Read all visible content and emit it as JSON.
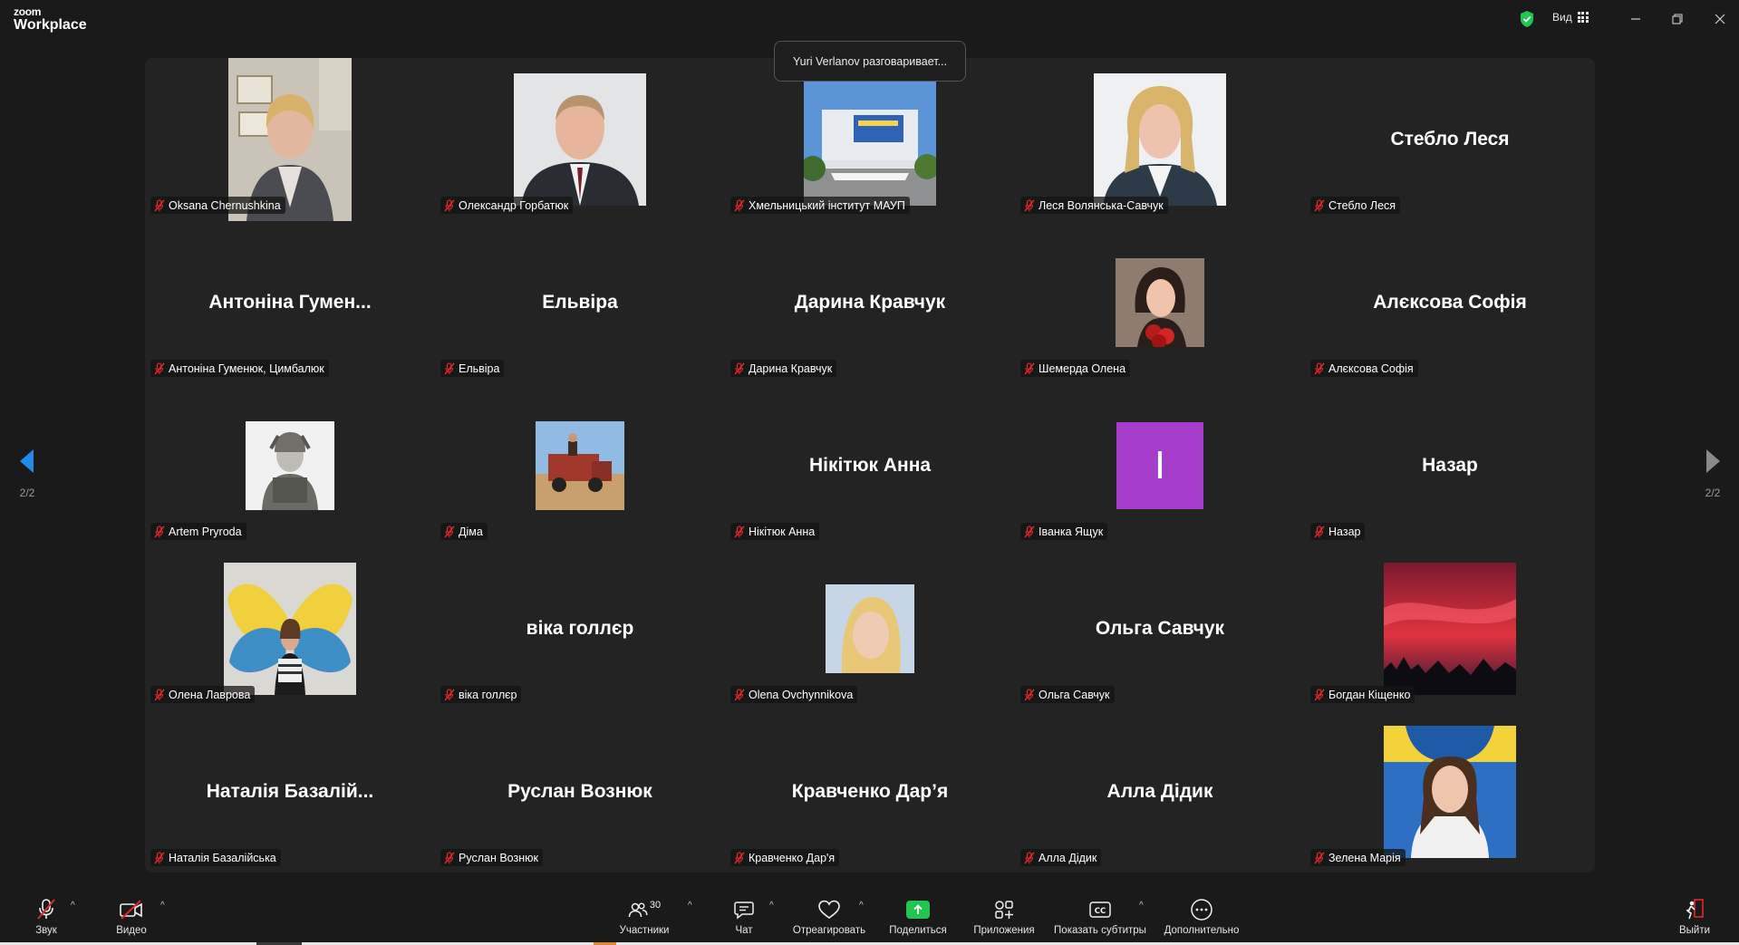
{
  "app": {
    "logo_line1": "zoom",
    "logo_line2": "Workplace",
    "view_label": "Вид"
  },
  "speaking_notice": "Yuri Verlanov разговаривает...",
  "pager": {
    "left": "2/2",
    "right": "2/2"
  },
  "participants": [
    {
      "label": "Oksana Chernushkina",
      "display": "photo",
      "photo_theme": "office-woman"
    },
    {
      "label": "Олександр Горбатюк",
      "display": "photo",
      "photo_theme": "suit-man"
    },
    {
      "label": "Хмельницький інститут МАУП",
      "display": "photo",
      "photo_theme": "building"
    },
    {
      "label": "Леся Волянська-Савчук",
      "display": "photo",
      "photo_theme": "blonde-woman"
    },
    {
      "label": "Стебло Леся",
      "display": "name",
      "name": "Стебло Леся"
    },
    {
      "label": "Антоніна Гуменюк, Цимбалюк",
      "display": "name",
      "name": "Антоніна Гумен..."
    },
    {
      "label": "Ельвіра",
      "display": "name",
      "name": "Ельвіра"
    },
    {
      "label": "Дарина Кравчук",
      "display": "name",
      "name": "Дарина Кравчук"
    },
    {
      "label": "Шемерда Олена",
      "display": "photo",
      "photo_theme": "woman-roses"
    },
    {
      "label": "Алєксова Софія",
      "display": "name",
      "name": "Алєксова Софія"
    },
    {
      "label": "Artem Pryroda",
      "display": "photo",
      "photo_theme": "soldier"
    },
    {
      "label": "Діма",
      "display": "photo",
      "photo_theme": "truck"
    },
    {
      "label": "Нікітюк Анна",
      "display": "name",
      "name": "Нікітюк Анна"
    },
    {
      "label": "Іванка Ящук",
      "display": "letter",
      "letter": "I",
      "color": "#a53fcb"
    },
    {
      "label": "Назар",
      "display": "name",
      "name": "Назар"
    },
    {
      "label": "Олена Лаврова",
      "display": "photo",
      "photo_theme": "wings"
    },
    {
      "label": "віка голлєр",
      "display": "name",
      "name": "віка голлєр"
    },
    {
      "label": "Olena Ovchynnikova",
      "display": "photo",
      "photo_theme": "blonde-selfie"
    },
    {
      "label": "Ольга Савчук",
      "display": "name",
      "name": "Ольга Савчук"
    },
    {
      "label": "Богдан Кіщенко",
      "display": "photo",
      "photo_theme": "red-sky"
    },
    {
      "label": "Наталія Базалійська",
      "display": "name",
      "name": "Наталія Базалій..."
    },
    {
      "label": "Руслан Вознюк",
      "display": "name",
      "name": "Руслан Вознюк"
    },
    {
      "label": "Кравченко Дар'я",
      "display": "name",
      "name": "Кравченко Дар’я"
    },
    {
      "label": "Алла Дідик",
      "display": "name",
      "name": "Алла Дідик"
    },
    {
      "label": "Зелена Марія",
      "display": "photo",
      "photo_theme": "woman-blue-wall"
    }
  ],
  "toolbar": {
    "audio": "Звук",
    "video": "Видео",
    "participants": "Участники",
    "participants_count": "30",
    "chat": "Чат",
    "react": "Отреагировать",
    "share": "Поделиться",
    "apps": "Приложения",
    "captions": "Показать субтитры",
    "more": "Дополнительно",
    "leave": "Выйти"
  },
  "colors": {
    "accent_blue": "#1f8ceb",
    "share_green": "#23c552",
    "mute_red": "#e02828",
    "avatar_purple": "#a53fcb"
  }
}
